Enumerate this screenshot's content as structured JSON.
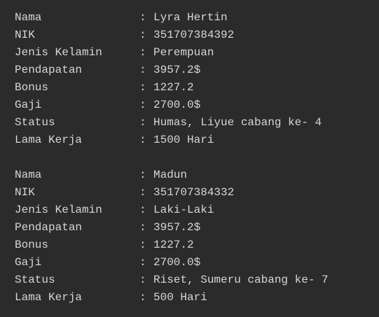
{
  "records": [
    {
      "rows": [
        {
          "key": "Nama",
          "value": "Lyra Hertin"
        },
        {
          "key": "NIK",
          "value": "351707384392"
        },
        {
          "key": "Jenis Kelamin",
          "value": "Perempuan"
        },
        {
          "key": "Pendapatan",
          "value": "3957.2$"
        },
        {
          "key": "Bonus",
          "value": "1227.2"
        },
        {
          "key": "Gaji",
          "value": "2700.0$"
        },
        {
          "key": "Status",
          "value": "Humas, Liyue cabang ke- 4"
        },
        {
          "key": "Lama Kerja",
          "value": "1500 Hari"
        }
      ]
    },
    {
      "rows": [
        {
          "key": "Nama",
          "value": "Madun"
        },
        {
          "key": "NIK",
          "value": "351707384332"
        },
        {
          "key": "Jenis Kelamin",
          "value": "Laki-Laki"
        },
        {
          "key": "Pendapatan",
          "value": "3957.2$"
        },
        {
          "key": "Bonus",
          "value": "1227.2"
        },
        {
          "key": "Gaji",
          "value": "2700.0$"
        },
        {
          "key": "Status",
          "value": "Riset, Sumeru cabang ke- 7"
        },
        {
          "key": "Lama Kerja",
          "value": "500 Hari"
        }
      ]
    }
  ],
  "separator": ":",
  "colors": {
    "background": "#2b2b2b",
    "text": "#d7d7d7"
  }
}
